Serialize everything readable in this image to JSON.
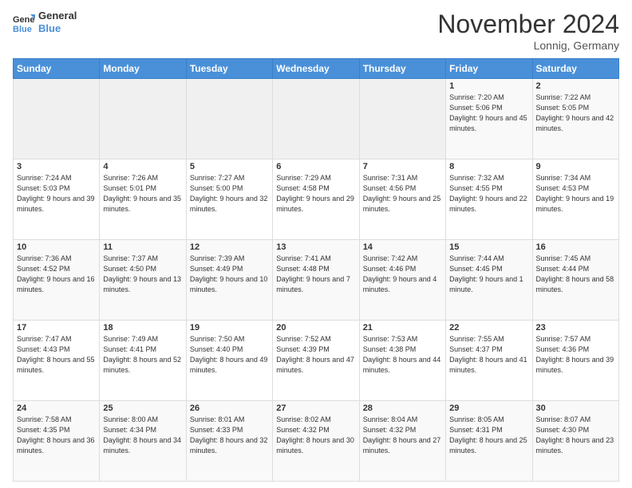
{
  "logo": {
    "text_general": "General",
    "text_blue": "Blue"
  },
  "header": {
    "month": "November 2024",
    "location": "Lonnig, Germany"
  },
  "weekdays": [
    "Sunday",
    "Monday",
    "Tuesday",
    "Wednesday",
    "Thursday",
    "Friday",
    "Saturday"
  ],
  "weeks": [
    [
      {
        "day": "",
        "info": ""
      },
      {
        "day": "",
        "info": ""
      },
      {
        "day": "",
        "info": ""
      },
      {
        "day": "",
        "info": ""
      },
      {
        "day": "",
        "info": ""
      },
      {
        "day": "1",
        "info": "Sunrise: 7:20 AM\nSunset: 5:06 PM\nDaylight: 9 hours and 45 minutes."
      },
      {
        "day": "2",
        "info": "Sunrise: 7:22 AM\nSunset: 5:05 PM\nDaylight: 9 hours and 42 minutes."
      }
    ],
    [
      {
        "day": "3",
        "info": "Sunrise: 7:24 AM\nSunset: 5:03 PM\nDaylight: 9 hours and 39 minutes."
      },
      {
        "day": "4",
        "info": "Sunrise: 7:26 AM\nSunset: 5:01 PM\nDaylight: 9 hours and 35 minutes."
      },
      {
        "day": "5",
        "info": "Sunrise: 7:27 AM\nSunset: 5:00 PM\nDaylight: 9 hours and 32 minutes."
      },
      {
        "day": "6",
        "info": "Sunrise: 7:29 AM\nSunset: 4:58 PM\nDaylight: 9 hours and 29 minutes."
      },
      {
        "day": "7",
        "info": "Sunrise: 7:31 AM\nSunset: 4:56 PM\nDaylight: 9 hours and 25 minutes."
      },
      {
        "day": "8",
        "info": "Sunrise: 7:32 AM\nSunset: 4:55 PM\nDaylight: 9 hours and 22 minutes."
      },
      {
        "day": "9",
        "info": "Sunrise: 7:34 AM\nSunset: 4:53 PM\nDaylight: 9 hours and 19 minutes."
      }
    ],
    [
      {
        "day": "10",
        "info": "Sunrise: 7:36 AM\nSunset: 4:52 PM\nDaylight: 9 hours and 16 minutes."
      },
      {
        "day": "11",
        "info": "Sunrise: 7:37 AM\nSunset: 4:50 PM\nDaylight: 9 hours and 13 minutes."
      },
      {
        "day": "12",
        "info": "Sunrise: 7:39 AM\nSunset: 4:49 PM\nDaylight: 9 hours and 10 minutes."
      },
      {
        "day": "13",
        "info": "Sunrise: 7:41 AM\nSunset: 4:48 PM\nDaylight: 9 hours and 7 minutes."
      },
      {
        "day": "14",
        "info": "Sunrise: 7:42 AM\nSunset: 4:46 PM\nDaylight: 9 hours and 4 minutes."
      },
      {
        "day": "15",
        "info": "Sunrise: 7:44 AM\nSunset: 4:45 PM\nDaylight: 9 hours and 1 minute."
      },
      {
        "day": "16",
        "info": "Sunrise: 7:45 AM\nSunset: 4:44 PM\nDaylight: 8 hours and 58 minutes."
      }
    ],
    [
      {
        "day": "17",
        "info": "Sunrise: 7:47 AM\nSunset: 4:43 PM\nDaylight: 8 hours and 55 minutes."
      },
      {
        "day": "18",
        "info": "Sunrise: 7:49 AM\nSunset: 4:41 PM\nDaylight: 8 hours and 52 minutes."
      },
      {
        "day": "19",
        "info": "Sunrise: 7:50 AM\nSunset: 4:40 PM\nDaylight: 8 hours and 49 minutes."
      },
      {
        "day": "20",
        "info": "Sunrise: 7:52 AM\nSunset: 4:39 PM\nDaylight: 8 hours and 47 minutes."
      },
      {
        "day": "21",
        "info": "Sunrise: 7:53 AM\nSunset: 4:38 PM\nDaylight: 8 hours and 44 minutes."
      },
      {
        "day": "22",
        "info": "Sunrise: 7:55 AM\nSunset: 4:37 PM\nDaylight: 8 hours and 41 minutes."
      },
      {
        "day": "23",
        "info": "Sunrise: 7:57 AM\nSunset: 4:36 PM\nDaylight: 8 hours and 39 minutes."
      }
    ],
    [
      {
        "day": "24",
        "info": "Sunrise: 7:58 AM\nSunset: 4:35 PM\nDaylight: 8 hours and 36 minutes."
      },
      {
        "day": "25",
        "info": "Sunrise: 8:00 AM\nSunset: 4:34 PM\nDaylight: 8 hours and 34 minutes."
      },
      {
        "day": "26",
        "info": "Sunrise: 8:01 AM\nSunset: 4:33 PM\nDaylight: 8 hours and 32 minutes."
      },
      {
        "day": "27",
        "info": "Sunrise: 8:02 AM\nSunset: 4:32 PM\nDaylight: 8 hours and 30 minutes."
      },
      {
        "day": "28",
        "info": "Sunrise: 8:04 AM\nSunset: 4:32 PM\nDaylight: 8 hours and 27 minutes."
      },
      {
        "day": "29",
        "info": "Sunrise: 8:05 AM\nSunset: 4:31 PM\nDaylight: 8 hours and 25 minutes."
      },
      {
        "day": "30",
        "info": "Sunrise: 8:07 AM\nSunset: 4:30 PM\nDaylight: 8 hours and 23 minutes."
      }
    ]
  ]
}
